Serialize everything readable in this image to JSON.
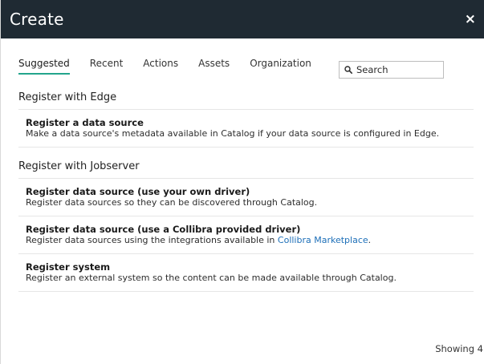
{
  "header": {
    "title": "Create",
    "close_label": "×"
  },
  "tabs": [
    {
      "label": "Suggested",
      "active": true
    },
    {
      "label": "Recent",
      "active": false
    },
    {
      "label": "Actions",
      "active": false
    },
    {
      "label": "Assets",
      "active": false
    },
    {
      "label": "Organization",
      "active": false
    }
  ],
  "search": {
    "placeholder": "Search",
    "icon": "search-icon"
  },
  "sections": [
    {
      "title": "Register with Edge",
      "items": [
        {
          "title": "Register a data source",
          "description": "Make a data source's metadata available in Catalog if your data source is configured in Edge."
        }
      ]
    },
    {
      "title": "Register with Jobserver",
      "items": [
        {
          "title": "Register data source (use your own driver)",
          "description": "Register data sources so they can be discovered through Catalog."
        },
        {
          "title": "Register data source (use a Collibra provided driver)",
          "description_prefix": "Register data sources using the integrations available in ",
          "description_link": "Collibra Marketplace",
          "description_suffix": "."
        },
        {
          "title": "Register system",
          "description": "Register an external system so the content can be made available through Catalog."
        }
      ]
    }
  ],
  "footer": {
    "showing": "Showing 4"
  },
  "colors": {
    "header_bg": "#1f2a33",
    "active_tab_underline": "#23a58c",
    "link": "#1d6fb8"
  }
}
